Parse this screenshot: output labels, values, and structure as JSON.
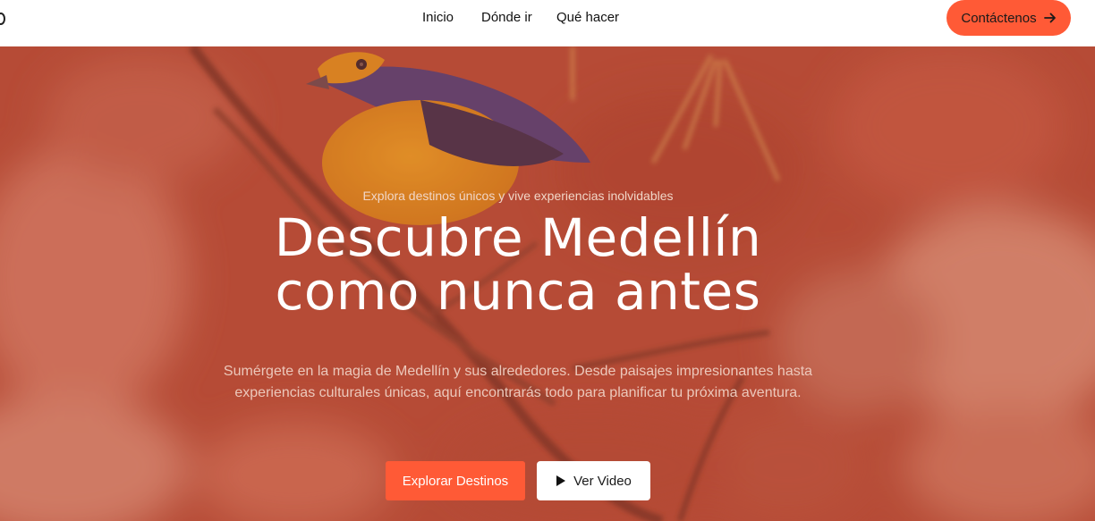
{
  "nav": {
    "items": [
      {
        "label": "Inicio"
      },
      {
        "label": "Dónde ir"
      },
      {
        "label": "Qué hacer"
      }
    ],
    "contact_label": "Contáctenos",
    "contact_icon": "arrow-right-icon"
  },
  "hero": {
    "tagline": "Explora destinos únicos y vive experiencias inolvidables",
    "title_line1": "Descubre Medellín",
    "title_line2": "como nunca antes",
    "description": "Sumérgete en la magia de Medellín y sus alrededores. Desde paisajes impresionantes hasta experiencias culturales únicas, aquí encontrarás todo para planificar tu próxima aventura.",
    "primary_button": "Explorar Destinos",
    "secondary_button": "Ver Video",
    "secondary_icon": "play-icon"
  },
  "colors": {
    "accent": "#ff5a36",
    "overlay": "#c4553c",
    "white": "#ffffff"
  }
}
